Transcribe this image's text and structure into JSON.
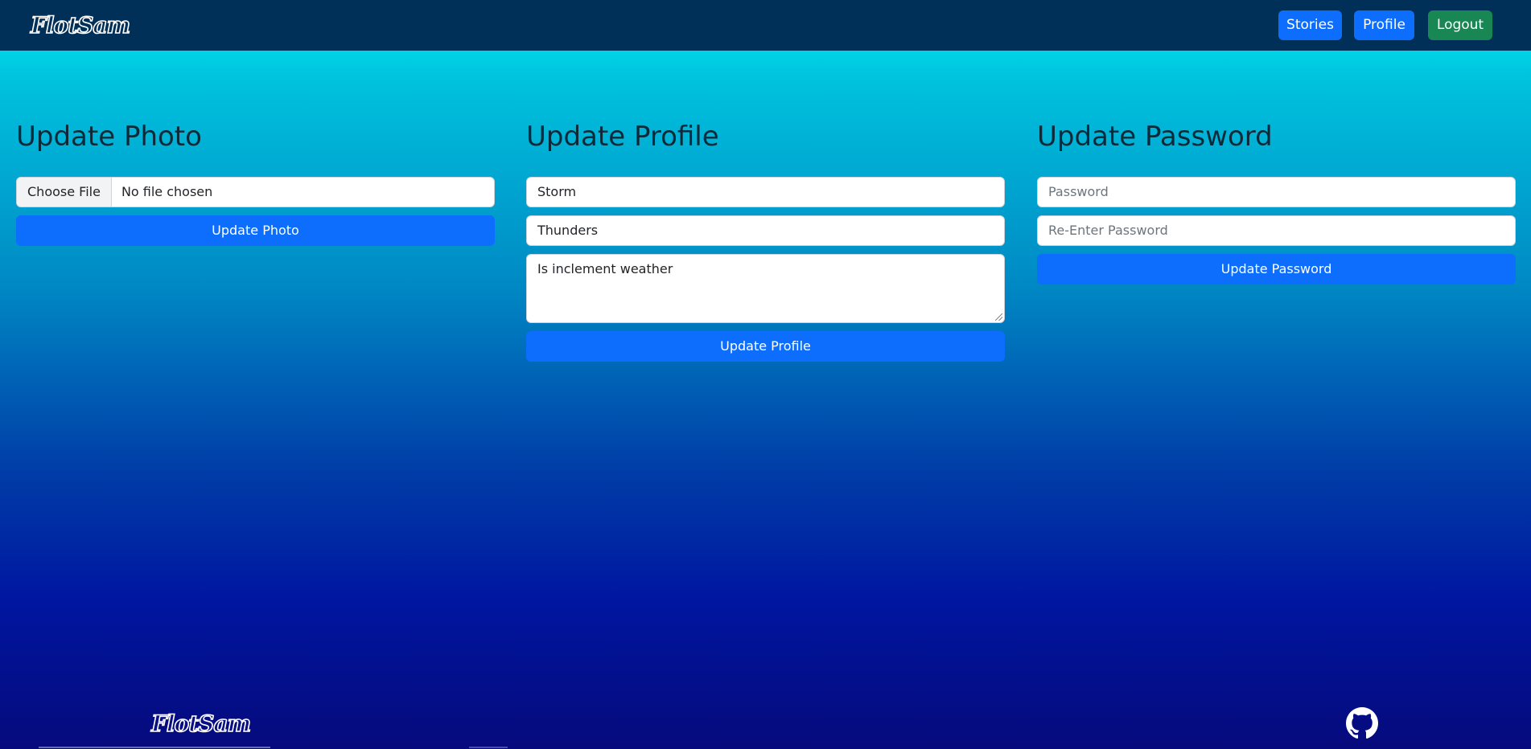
{
  "navbar": {
    "brand": "FlotSam",
    "buttons": {
      "stories": "Stories",
      "profile": "Profile",
      "logout": "Logout"
    }
  },
  "photo": {
    "title": "Update Photo",
    "file_button": "Choose File",
    "file_status": "No file chosen",
    "submit": "Update Photo"
  },
  "profile": {
    "title": "Update Profile",
    "first_name": "Storm",
    "last_name": "Thunders",
    "bio": "Is inclement weather",
    "submit": "Update Profile"
  },
  "password": {
    "title": "Update Password",
    "password_placeholder": "Password",
    "reenter_placeholder": "Re-Enter Password",
    "submit": "Update Password"
  },
  "footer": {
    "brand": "FlotSam",
    "github_icon": "github-icon"
  },
  "colors": {
    "navbar": "#002f58",
    "primary": "#0d6efd",
    "success": "#198754"
  }
}
